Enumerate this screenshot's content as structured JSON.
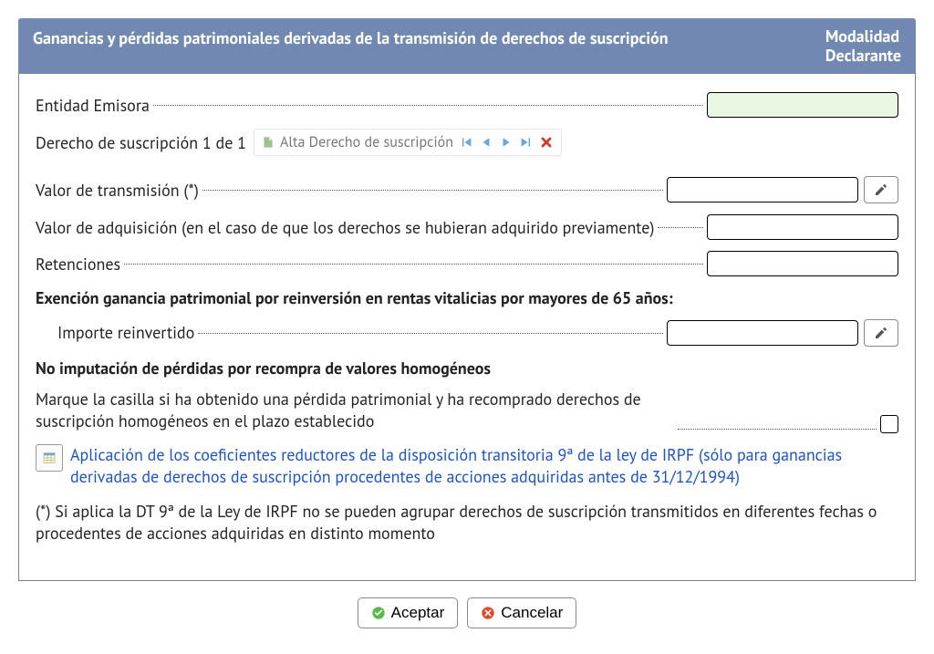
{
  "header": {
    "title": "Ganancias y pérdidas patrimoniales derivadas de la transmisión de derechos de suscripción",
    "modality_l1": "Modalidad",
    "modality_l2": "Declarante"
  },
  "entidad": {
    "label": "Entidad Emisora",
    "value": ""
  },
  "derecho": {
    "counter": "Derecho de suscripción 1 de 1",
    "add_label": "Alta Derecho de suscripción"
  },
  "valor_transmision": {
    "label": "Valor de transmisión (*)",
    "value": ""
  },
  "valor_adquisicion": {
    "label": "Valor de adquisición (en el caso de que los derechos se hubieran adquirido previamente)",
    "value": ""
  },
  "retenciones": {
    "label": "Retenciones",
    "value": ""
  },
  "exencion_heading": "Exención ganancia patrimonial por reinversión en rentas vitalicias por mayores de 65 años:",
  "importe_reinvertido": {
    "label": "Importe reinvertido",
    "value": ""
  },
  "no_imputacion_heading": "No imputación de pérdidas por recompra de valores homogéneos",
  "no_imputacion_text": "Marque la casilla si ha obtenido una pérdida patrimonial y ha recomprado derechos de suscripción homogéneos en el plazo establecido",
  "coef_link": "Aplicación de los coeficientes reductores de la disposición transitoria 9ª de la ley de IRPF (sólo para ganancias derivadas de derechos de suscripción procedentes de acciones adquiridas antes de 31/12/1994)",
  "footnote": "(*) Si aplica la DT 9ª de la Ley de IRPF no se pueden agrupar derechos de suscripción transmitidos en diferentes fechas o procedentes de acciones adquiridas en distinto momento",
  "buttons": {
    "accept": "Aceptar",
    "cancel": "Cancelar"
  }
}
